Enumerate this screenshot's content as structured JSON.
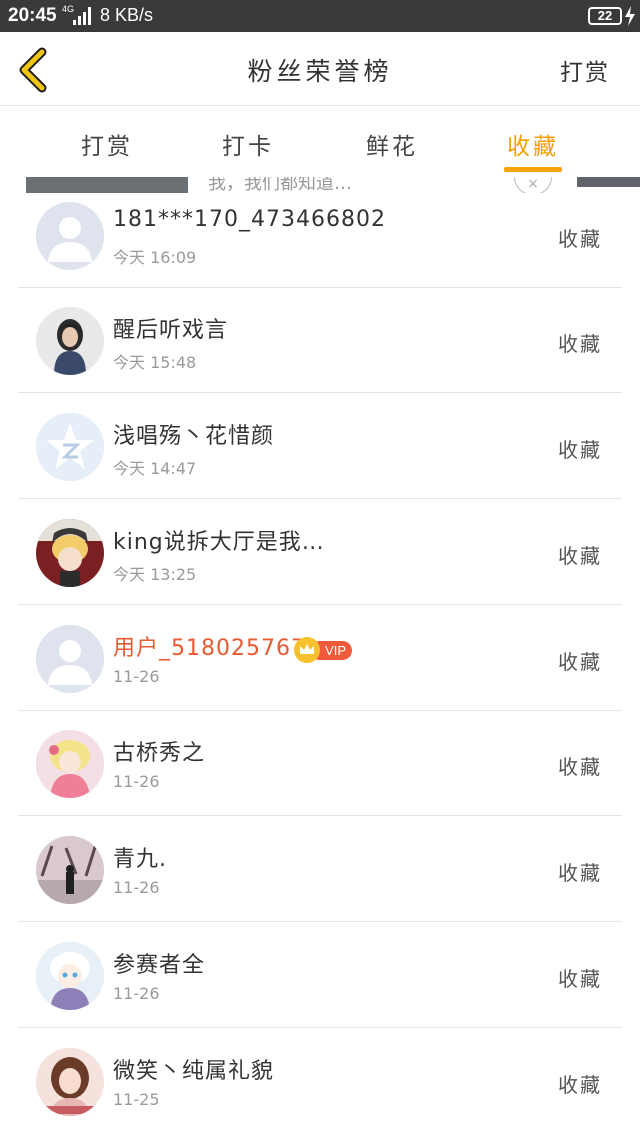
{
  "status_bar": {
    "time": "20:45",
    "network": "4G",
    "speed": "8 KB/s",
    "battery": "22"
  },
  "header": {
    "title": "粉丝荣誉榜",
    "action_label": "打赏"
  },
  "tabs": [
    {
      "label": "打赏",
      "active": false
    },
    {
      "label": "打卡",
      "active": false
    },
    {
      "label": "鲜花",
      "active": false
    },
    {
      "label": "收藏",
      "active": true
    }
  ],
  "ad_strip": {
    "text": "我，我们都知道…"
  },
  "list": [
    {
      "name": "181***170_473466802",
      "time": "今天 16:09",
      "status": "收藏",
      "vip": false,
      "avatar": "default-user"
    },
    {
      "name": "醒后听戏言",
      "time": "今天 15:48",
      "status": "收藏",
      "vip": false,
      "avatar": "dark-hair-photo"
    },
    {
      "name": "浅唱殇丶花惜颜",
      "time": "今天 14:47",
      "status": "收藏",
      "vip": false,
      "avatar": "qq-star-logo"
    },
    {
      "name": "king说拆大厅是我…",
      "time": "今天 13:25",
      "status": "收藏",
      "vip": false,
      "avatar": "anime-blonde"
    },
    {
      "name": "用户_518025767",
      "time": "11-26",
      "status": "收藏",
      "vip": true,
      "vip_label": "VIP",
      "avatar": "default-user"
    },
    {
      "name": "古桥秀之",
      "time": "11-26",
      "status": "收藏",
      "vip": false,
      "avatar": "anime-pink"
    },
    {
      "name": "青九.",
      "time": "11-26",
      "status": "收藏",
      "vip": false,
      "avatar": "snow-photo"
    },
    {
      "name": "参赛者全",
      "time": "11-26",
      "status": "收藏",
      "vip": false,
      "avatar": "anime-white"
    },
    {
      "name": "微笑丶纯属礼貌",
      "time": "11-25",
      "status": "收藏",
      "vip": false,
      "avatar": "girl-photo"
    }
  ],
  "colors": {
    "status_bar": "#3a3a3a",
    "accent": "#f5a20b",
    "vip_name": "#e85a32",
    "vip_pill": "#ef5a3a",
    "back_arrow": "#f1c40f"
  }
}
